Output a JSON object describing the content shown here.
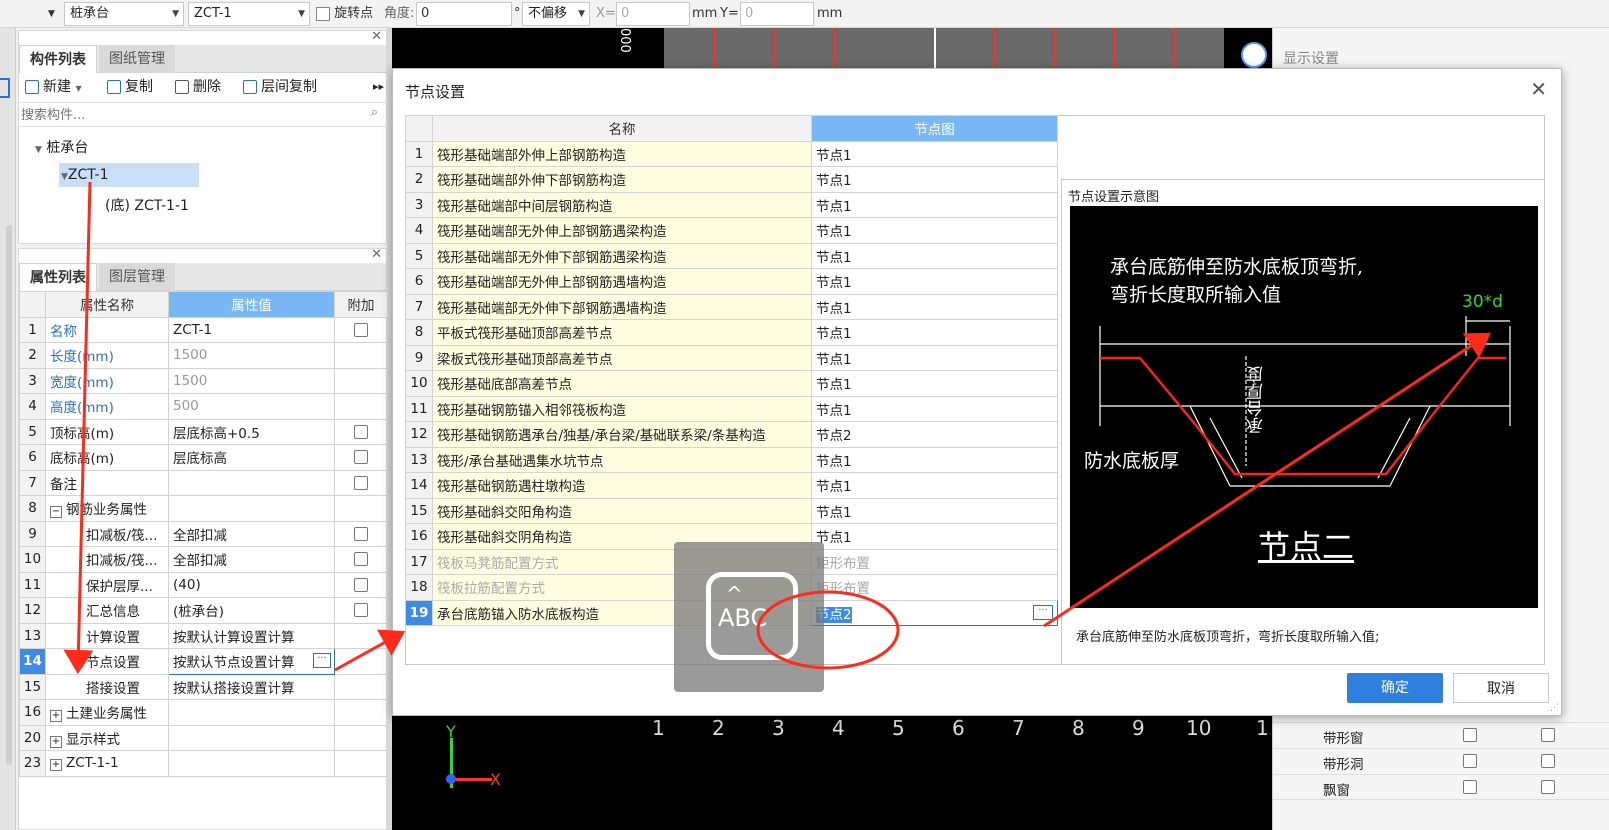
{
  "toolbar": {
    "type_value": "桩承台",
    "component_value": "ZCT-1",
    "rotate_label": "旋转点",
    "angle_label": "角度:",
    "angle_value": "0",
    "degree_symbol": "°",
    "offset_value": "不偏移",
    "x_label": "X=",
    "x_value": "0",
    "x_unit": "mm",
    "y_label": "Y=",
    "y_value": "0",
    "y_unit": "mm"
  },
  "component_panel": {
    "tabs": [
      "构件列表",
      "图纸管理"
    ],
    "tools": {
      "new": "新建",
      "copy": "复制",
      "delete": "删除",
      "floor_copy": "层间复制"
    },
    "search_placeholder": "搜索构件...",
    "tree": {
      "root": "桩承台",
      "child": "ZCT-1",
      "grandchild": "(底) ZCT-1-1"
    }
  },
  "property_panel": {
    "tabs": [
      "属性列表",
      "图层管理"
    ],
    "headers": {
      "name": "属性名称",
      "value": "属性值",
      "extra": "附加"
    },
    "rows": [
      {
        "n": "1",
        "name": "名称",
        "value": "ZCT-1",
        "check": true
      },
      {
        "n": "2",
        "name": "长度(mm)",
        "value": "1500",
        "check": false
      },
      {
        "n": "3",
        "name": "宽度(mm)",
        "value": "1500",
        "check": false
      },
      {
        "n": "4",
        "name": "高度(mm)",
        "value": "500",
        "check": false
      },
      {
        "n": "5",
        "name": "顶标高(m)",
        "value": "层底标高+0.5",
        "check": true
      },
      {
        "n": "6",
        "name": "底标高(m)",
        "value": "层底标高",
        "check": true
      },
      {
        "n": "7",
        "name": "备注",
        "value": "",
        "check": true
      },
      {
        "n": "8",
        "name": "钢筋业务属性",
        "value": "",
        "check": false
      },
      {
        "n": "9",
        "name": "扣减板/筏...",
        "value": "全部扣减",
        "check": true
      },
      {
        "n": "10",
        "name": "扣减板/筏...",
        "value": "全部扣减",
        "check": true
      },
      {
        "n": "11",
        "name": "保护层厚...",
        "value": "(40)",
        "check": true
      },
      {
        "n": "12",
        "name": "汇总信息",
        "value": "(桩承台)",
        "check": true
      },
      {
        "n": "13",
        "name": "计算设置",
        "value": "按默认计算设置计算",
        "check": false
      },
      {
        "n": "14",
        "name": "节点设置",
        "value": "按默认节点设置计算",
        "check": false
      },
      {
        "n": "15",
        "name": "搭接设置",
        "value": "按默认搭接设置计算",
        "check": false
      },
      {
        "n": "16",
        "name": "土建业务属性",
        "value": "",
        "check": false
      },
      {
        "n": "20",
        "name": "显示样式",
        "value": "",
        "check": false
      },
      {
        "n": "23",
        "name": "ZCT-1-1",
        "value": "",
        "check": false
      }
    ]
  },
  "dialog": {
    "title": "节点设置",
    "headers": {
      "name": "名称",
      "node": "节点图"
    },
    "rows": [
      {
        "n": "1",
        "name": "筏形基础端部外伸上部钢筋构造",
        "value": "节点1"
      },
      {
        "n": "2",
        "name": "筏形基础端部外伸下部钢筋构造",
        "value": "节点1"
      },
      {
        "n": "3",
        "name": "筏形基础端部中间层钢筋构造",
        "value": "节点1"
      },
      {
        "n": "4",
        "name": "筏形基础端部无外伸上部钢筋遇梁构造",
        "value": "节点1"
      },
      {
        "n": "5",
        "name": "筏形基础端部无外伸下部钢筋遇梁构造",
        "value": "节点1"
      },
      {
        "n": "6",
        "name": "筏形基础端部无外伸上部钢筋遇墙构造",
        "value": "节点1"
      },
      {
        "n": "7",
        "name": "筏形基础端部无外伸下部钢筋遇墙构造",
        "value": "节点1"
      },
      {
        "n": "8",
        "name": "平板式筏形基础顶部高差节点",
        "value": "节点1"
      },
      {
        "n": "9",
        "name": "梁板式筏形基础顶部高差节点",
        "value": "节点1"
      },
      {
        "n": "10",
        "name": "筏形基础底部高差节点",
        "value": "节点1"
      },
      {
        "n": "11",
        "name": "筏形基础钢筋锚入相邻筏板构造",
        "value": "节点1"
      },
      {
        "n": "12",
        "name": "筏形基础钢筋遇承台/独基/承台梁/基础联系梁/条基构造",
        "value": "节点2"
      },
      {
        "n": "13",
        "name": "筏形/承台基础遇集水坑节点",
        "value": "节点1"
      },
      {
        "n": "14",
        "name": "筏形基础钢筋遇柱墩构造",
        "value": "节点1"
      },
      {
        "n": "15",
        "name": "筏形基础斜交阳角构造",
        "value": "节点1"
      },
      {
        "n": "16",
        "name": "筏形基础斜交阴角构造",
        "value": "节点1"
      },
      {
        "n": "17",
        "name": "筏板马凳筋配置方式",
        "value": "矩形布置"
      },
      {
        "n": "18",
        "name": "筏板拉筋配置方式",
        "value": "矩形布置"
      },
      {
        "n": "19",
        "name": "承台底筋锚入防水底板构造",
        "value": "节点2"
      }
    ],
    "diagram_title": "节点设置示意图",
    "diagram_text": {
      "line1": "承台底筋伸至防水底板顶弯折,",
      "line2": "弯折长度取所输入值",
      "dim": "30*d",
      "thickness": "承台厚度",
      "waterproof": "防水底板厚",
      "node": "节点二"
    },
    "description": "承台底筋伸至防水底板顶弯折，弯折长度取所输入值;",
    "ok": "确定",
    "cancel": "取消"
  },
  "ime_overlay": {
    "label": "ABC"
  },
  "canvas": {
    "axis_labels": [
      "1",
      "2",
      "3",
      "4",
      "5",
      "6",
      "7",
      "8",
      "9",
      "10",
      "1"
    ],
    "top_marker": "000",
    "x_axis": "X",
    "y_axis": "Y"
  },
  "display_panel": {
    "title": "显示设置",
    "rows": [
      {
        "name": "带形窗"
      },
      {
        "name": "带形洞"
      },
      {
        "name": "飘窗"
      }
    ]
  },
  "colors": {
    "accent": "#3d8be6",
    "annotation": "#ff2a1a",
    "cad_bg": "#000000"
  }
}
